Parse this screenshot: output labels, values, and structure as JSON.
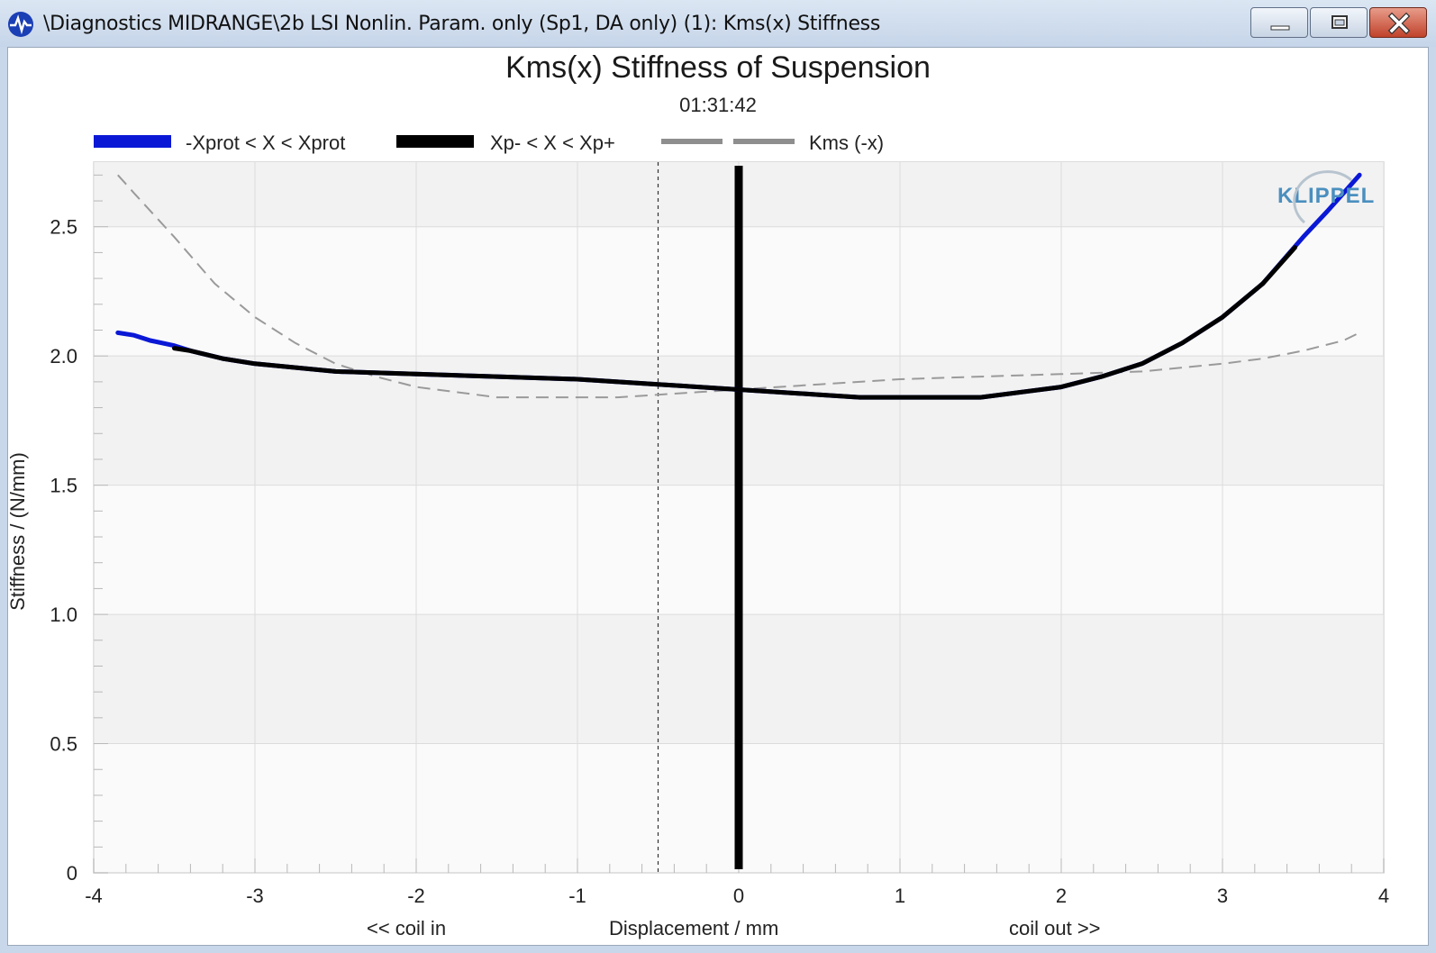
{
  "window": {
    "title": "\\Diagnostics MIDRANGE\\2b LSI Nonlin. Param. only (Sp1, DA only) (1): Kms(x) Stiffness",
    "controls": [
      "minimize",
      "maximize",
      "close"
    ]
  },
  "colors": {
    "protected": "#0a18d6",
    "xp": "#000000",
    "mirrored": "#9a9a9a",
    "logo": "#4a8fbf"
  },
  "logo": {
    "text": "KLIPPEL"
  },
  "chart_data": {
    "type": "line",
    "title": "Kms(x) Stiffness of Suspension",
    "subtitle": "01:31:42",
    "xlabel": "Displacement / mm",
    "xlabel_left": "<< coil in",
    "xlabel_right": "coil out >>",
    "ylabel": "Stiffness / (N/mm)",
    "xlim": [
      -4,
      4
    ],
    "ylim": [
      0,
      2.75
    ],
    "xticks": [
      "-4",
      "-3",
      "-2",
      "-1",
      "0",
      "1",
      "2",
      "3",
      "4"
    ],
    "yticks": [
      "0",
      "0.5",
      "1.0",
      "1.5",
      "2.0",
      "2.5"
    ],
    "grid": true,
    "legend_position": "top",
    "series": [
      {
        "name": "-Xprot < X < Xprot",
        "style": "blue-solid",
        "x": [
          -3.85,
          -3.75,
          -3.65,
          -3.5,
          -3.4,
          -3.2,
          -3.0,
          -2.5,
          -2.0,
          -1.5,
          -1.0,
          -0.5,
          0.0,
          0.5,
          0.75,
          1.0,
          1.5,
          2.0,
          2.25,
          2.5,
          2.75,
          3.0,
          3.25,
          3.5,
          3.65,
          3.75,
          3.85
        ],
        "y": [
          2.09,
          2.08,
          2.06,
          2.04,
          2.02,
          1.99,
          1.97,
          1.94,
          1.93,
          1.92,
          1.91,
          1.89,
          1.87,
          1.85,
          1.84,
          1.84,
          1.84,
          1.88,
          1.92,
          1.97,
          2.05,
          2.15,
          2.28,
          2.46,
          2.56,
          2.63,
          2.7
        ]
      },
      {
        "name": "Xp- < X < Xp+",
        "style": "black-solid",
        "x": [
          -3.5,
          -3.4,
          -3.2,
          -3.0,
          -2.5,
          -2.0,
          -1.5,
          -1.0,
          -0.5,
          0.0,
          0.5,
          0.75,
          1.0,
          1.5,
          2.0,
          2.25,
          2.5,
          2.75,
          3.0,
          3.25,
          3.45
        ],
        "y": [
          2.03,
          2.02,
          1.99,
          1.97,
          1.94,
          1.93,
          1.92,
          1.91,
          1.89,
          1.87,
          1.85,
          1.84,
          1.84,
          1.84,
          1.88,
          1.92,
          1.97,
          2.05,
          2.15,
          2.28,
          2.42
        ]
      },
      {
        "name": "Kms (-x)",
        "style": "gray-dashed",
        "x": [
          -3.85,
          -3.75,
          -3.5,
          -3.25,
          -3.0,
          -2.75,
          -2.5,
          -2.25,
          -2.0,
          -1.75,
          -1.5,
          -1.25,
          -1.0,
          -0.75,
          -0.5,
          -0.25,
          0.0,
          0.5,
          1.0,
          1.5,
          2.0,
          2.5,
          3.0,
          3.25,
          3.5,
          3.75,
          3.85
        ],
        "y": [
          2.7,
          2.63,
          2.46,
          2.28,
          2.15,
          2.05,
          1.97,
          1.92,
          1.88,
          1.86,
          1.84,
          1.84,
          1.84,
          1.84,
          1.85,
          1.86,
          1.87,
          1.89,
          1.91,
          1.92,
          1.93,
          1.94,
          1.97,
          1.99,
          2.02,
          2.06,
          2.09
        ]
      }
    ],
    "markers": [
      {
        "type": "vertical-line",
        "x": 0.0,
        "style": "black-thick"
      },
      {
        "type": "vertical-line",
        "x": -0.5,
        "style": "black-dotted"
      }
    ]
  }
}
